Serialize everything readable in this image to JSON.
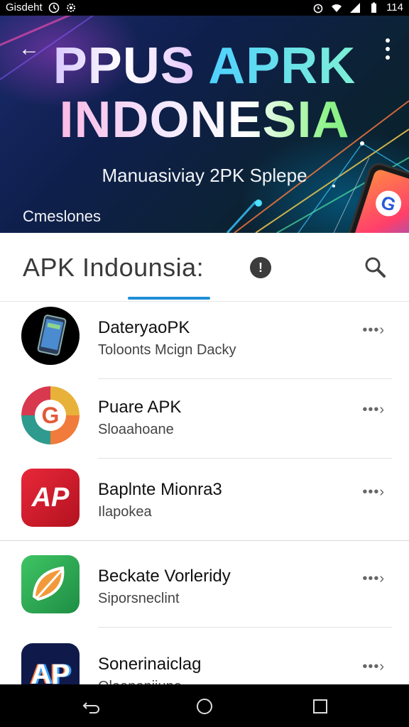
{
  "status_bar": {
    "left_text": "Gisdeht",
    "time": "114",
    "icons": [
      "clock-icon",
      "settings-icon",
      "alarm-icon",
      "wifi-icon",
      "signal-icon",
      "battery-icon"
    ]
  },
  "hero": {
    "title_line1_a": "PPUS",
    "title_line1_b": "APRK",
    "title_line2": "INDONESIA",
    "subtitle": "Manuasiviay 2PK Splepe",
    "small_text": "Cmeslones",
    "phone_glyph": "G"
  },
  "header": {
    "title": "APK Indounsia:",
    "info_glyph": "!"
  },
  "apps": [
    {
      "title": "DateryaoPK",
      "subtitle": "Toloonts Mcign Dacky",
      "more": "•••›"
    },
    {
      "title": "Puare APK",
      "subtitle": "Sloaahoane",
      "more": "•••›"
    },
    {
      "title": "Baplnte Mionra3",
      "subtitle": "Ilapokea",
      "more": "•••›",
      "icon_text": "AP"
    },
    {
      "title": "Beckate Vorleridy",
      "subtitle": "Siporsneclint",
      "more": "•••›"
    },
    {
      "title": "Sonerinaiclag",
      "subtitle": "Oleanoniiune",
      "more": "•••›",
      "icon_text": "AP"
    }
  ],
  "colors": {
    "accent": "#1e8fd6",
    "hero_bg": "#0f1f4d"
  }
}
